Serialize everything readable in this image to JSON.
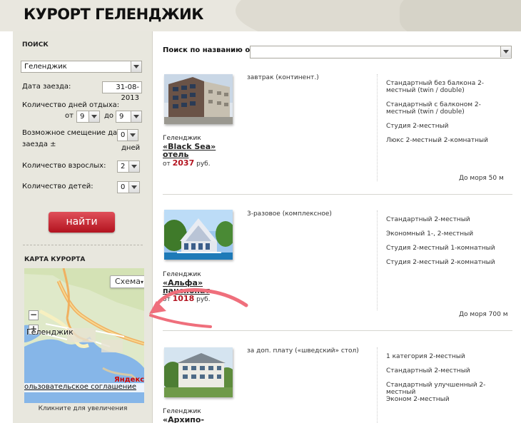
{
  "header": {
    "title": "КУРОРТ ГЕЛЕНДЖИК"
  },
  "sidebar": {
    "search_heading": "ПОИСК",
    "city_value": "Геленджик",
    "arrival_label": "Дата заезда:",
    "arrival_value": "31-08-2013",
    "days_label": "Количество дней отдыха:",
    "from_label": "от",
    "from_value": "9",
    "to_label": "до",
    "to_value": "9",
    "shift_label_line1": "Возможное смещение даты",
    "shift_label_line2": "заезда ±",
    "shift_value": "0",
    "shift_unit": "дней",
    "adults_label": "Количество взрослых:",
    "adults_value": "2",
    "children_label": "Количество детей:",
    "children_value": "0",
    "find_button": "найти",
    "map_heading": "КАРТА КУРОРТА",
    "map_caption": "Кликните для увеличения"
  },
  "map": {
    "scheme_label": "Схема",
    "zoom_out": "−",
    "zoom_in": "+",
    "city_label": "Геленджик",
    "brand": "Яндекс",
    "agreement": "ользовательское соглашение"
  },
  "main": {
    "search_label": "Поиск по названию отеля",
    "search_value": "",
    "hotels": [
      {
        "city": "Геленджик",
        "name_line1": "«Black Sea»",
        "name_line2": "отель",
        "price_prefix": "от",
        "price": "2037",
        "price_suffix": "руб.",
        "meal": "завтрак (континент.)",
        "rooms": [
          "Стандартный без балкона 2-местный (twin / double)",
          "Стандартный с балконом 2-местный (twin / double)",
          "Студия 2-местный",
          "Люкс 2-местный 2-комнатный"
        ],
        "sea": "До моря 50 м"
      },
      {
        "city": "Геленджик",
        "name_line1": "«Альфа»",
        "name_line2": "пансионат",
        "price_prefix": "от",
        "price": "1018",
        "price_suffix": "руб.",
        "meal": "3-разовое (комплексное)",
        "rooms": [
          "Стандартный 2-местный",
          "Экономный 1-, 2-местный",
          "Студия 2-местный 1-комнатный",
          "Студия 2-местный 2-комнатный"
        ],
        "sea": "До моря 700 м"
      },
      {
        "city": "Геленджик",
        "name_line1": "«Архипо-",
        "meal": "за доп. плату («шведский» стол)",
        "rooms": [
          "1 категория 2-местный",
          "Стандартный 2-местный",
          "Стандартный улучшенный 2-местный",
          "Эконом 2-местный"
        ]
      }
    ]
  },
  "colors": {
    "accent": "#b3131f",
    "sidebar_bg": "#e8e7de",
    "annotation_arrow": "#ef6f7c"
  }
}
